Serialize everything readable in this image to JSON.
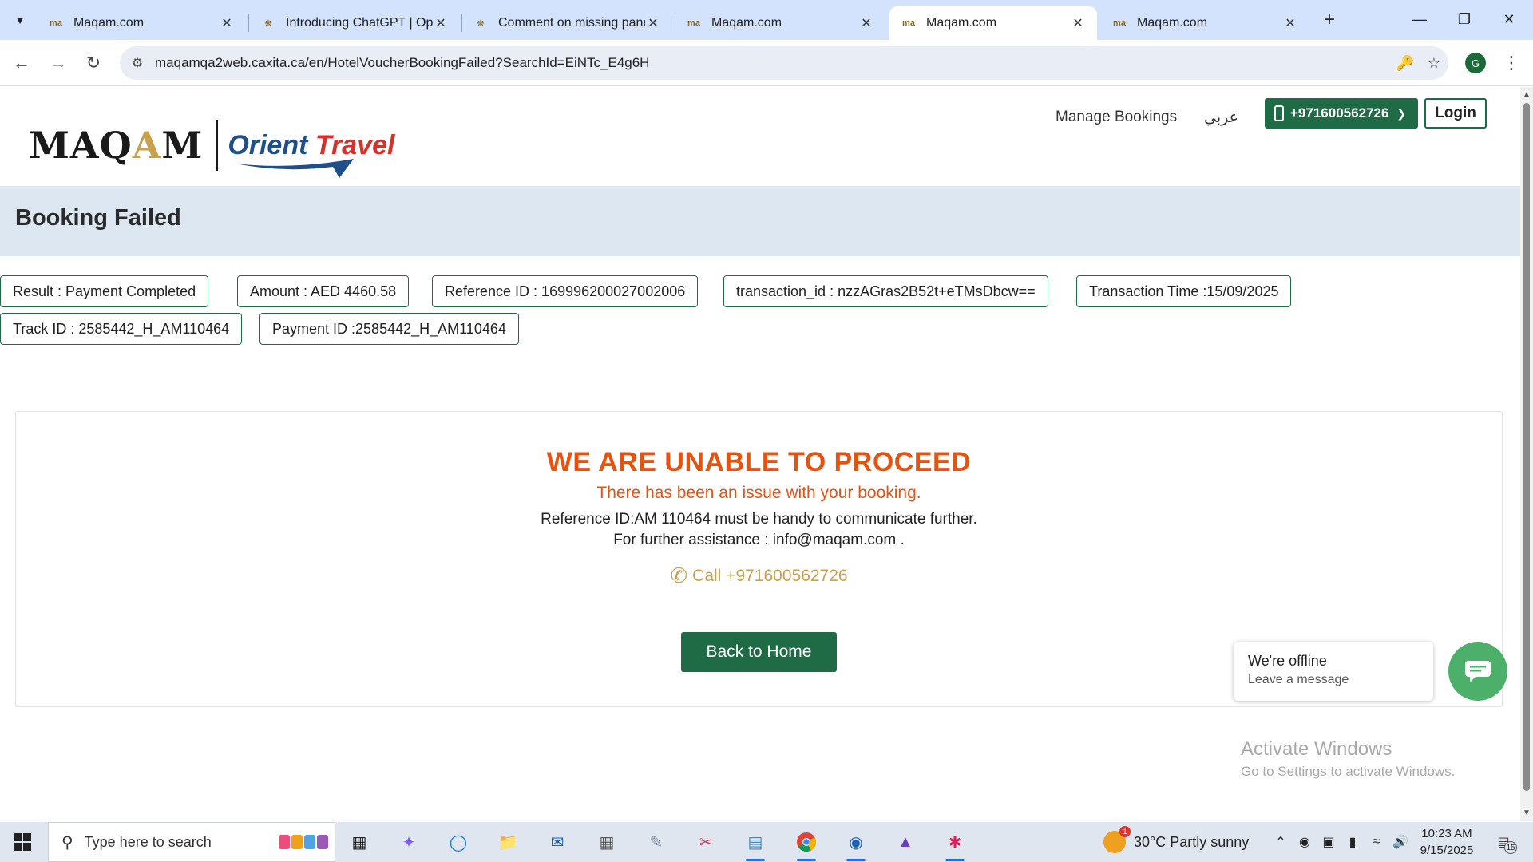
{
  "browser": {
    "tabs": [
      {
        "title": "Maqam.com",
        "active": false
      },
      {
        "title": "Introducing ChatGPT | Ope",
        "active": false
      },
      {
        "title": "Comment on missing pane",
        "active": false
      },
      {
        "title": "Maqam.com",
        "active": false
      },
      {
        "title": "Maqam.com",
        "active": true
      },
      {
        "title": "Maqam.com",
        "active": false
      }
    ],
    "url": "maqamqa2web.caxita.ca/en/HotelVoucherBookingFailed?SearchId=EiNTc_E4g6H",
    "profile_initial": "G"
  },
  "header": {
    "logo_text_left": "MAQ",
    "logo_text_gold": "A",
    "logo_text_right": "M",
    "logo_orient": "Orient",
    "logo_travel": "Travel",
    "manage_bookings": "Manage Bookings",
    "arabic": "عربي",
    "phone": "+971600562726",
    "login": "Login"
  },
  "page_title": "Booking Failed",
  "details": [
    "Result : Payment Completed",
    "Amount : AED 4460.58",
    "Reference ID : 169996200027002006",
    "transaction_id : nzzAGras2B52t+eTMsDbcw==",
    "Transaction Time :15/09/2025",
    "Track ID : 2585442_H_AM110464",
    "Payment ID :2585442_H_AM110464"
  ],
  "result": {
    "headline": "WE ARE UNABLE TO PROCEED",
    "subline": "There has been an issue with your booking.",
    "reference_note": "Reference ID:AM 110464 must be handy to communicate further.",
    "assistance": "For further assistance : info@maqam.com .",
    "call": "Call +971600562726",
    "back_button": "Back to Home"
  },
  "chat": {
    "status": "We're offline",
    "prompt": "Leave a message"
  },
  "watermark": {
    "line1": "Activate Windows",
    "line2": "Go to Settings to activate Windows."
  },
  "taskbar": {
    "search_placeholder": "Type here to search",
    "weather": "30°C  Partly sunny",
    "weather_badge": "1",
    "time": "10:23 AM",
    "date": "9/15/2025",
    "notifications": "15"
  },
  "colors": {
    "brand_green": "#1f6b45",
    "alert_orange": "#e8520f",
    "gold": "#c9a14b",
    "title_band": "#dde7f2"
  }
}
